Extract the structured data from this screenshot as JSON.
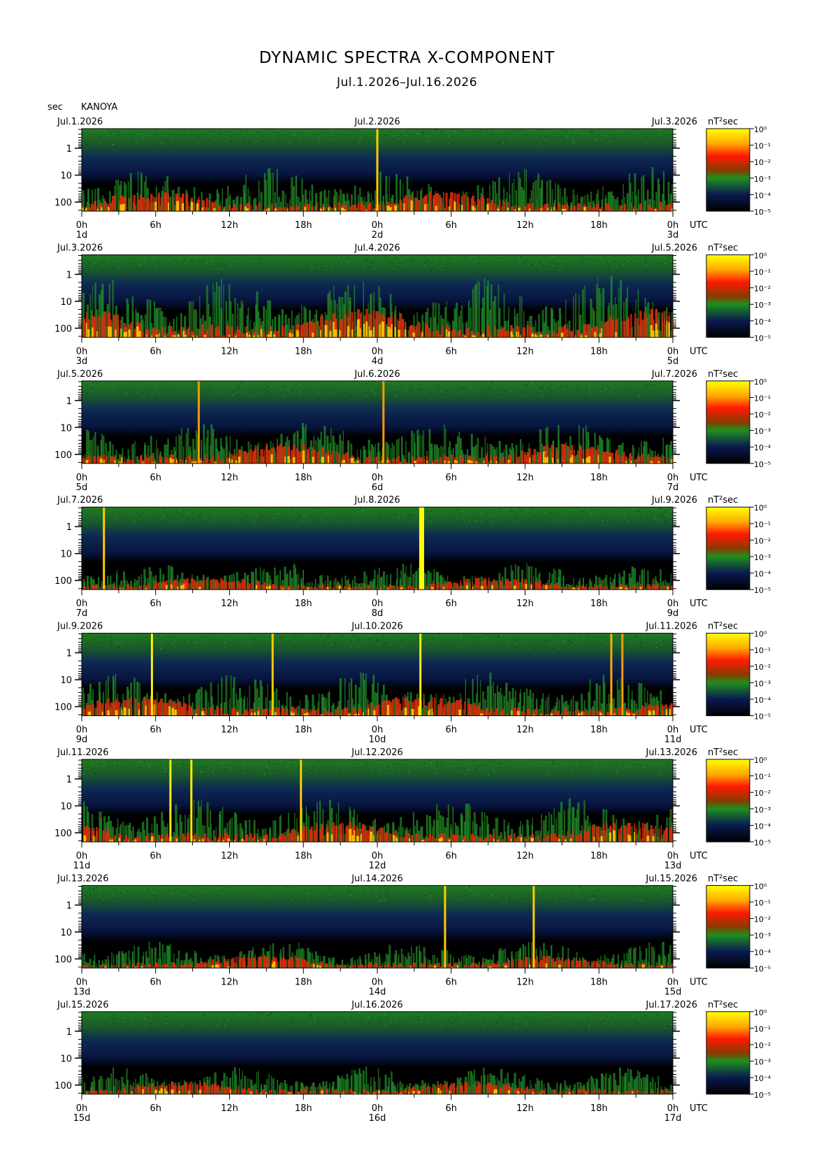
{
  "title": "DYNAMIC SPECTRA X-COMPONENT",
  "subtitle": "Jul.1.2026–Jul.16.2026",
  "y_unit": "sec",
  "station": "KANOYA",
  "chart_data": {
    "type": "heatmap",
    "period_axis": {
      "ticks": [
        "1",
        "10",
        "100"
      ],
      "scale": "log",
      "unit": "sec"
    },
    "time_axis_ticks": [
      "0h",
      "6h",
      "12h",
      "18h",
      "0h",
      "6h",
      "12h",
      "18h",
      "0h"
    ],
    "time_zone_label": "UTC",
    "colorbar": {
      "unit_label": "nT²sec",
      "ticks": [
        "10⁰",
        "10⁻¹",
        "10⁻²",
        "10⁻³",
        "10⁻⁴",
        "10⁻⁵"
      ],
      "colors": [
        "#ffff00",
        "#ff8c00",
        "#ff1a00",
        "#1f8f1f",
        "#0a1a50",
        "#000000"
      ]
    },
    "panels": [
      {
        "dates": [
          "Jul.1.2026",
          "Jul.2.2026",
          "Jul.3.2026"
        ],
        "day_labels": [
          "1d",
          "2d",
          "3d"
        ],
        "spikes": [
          {
            "t": 24.0,
            "color": "#ffcc00"
          }
        ],
        "activity": "moderate"
      },
      {
        "dates": [
          "Jul.3.2026",
          "Jul.4.2026",
          "Jul.5.2026"
        ],
        "day_labels": [
          "3d",
          "4d",
          "5d"
        ],
        "spikes": [],
        "activity": "high"
      },
      {
        "dates": [
          "Jul.5.2026",
          "Jul.6.2026",
          "Jul.7.2026"
        ],
        "day_labels": [
          "5d",
          "6d",
          "7d"
        ],
        "spikes": [
          {
            "t": 9.5,
            "color": "#ff9900"
          },
          {
            "t": 24.5,
            "color": "#ff9900"
          }
        ],
        "activity": "moderate"
      },
      {
        "dates": [
          "Jul.7.2026",
          "Jul.8.2026",
          "Jul.9.2026"
        ],
        "day_labels": [
          "7d",
          "8d",
          "9d"
        ],
        "spikes": [
          {
            "t": 1.8,
            "color": "#ffcc00"
          },
          {
            "t": 27.6,
            "color": "#ffff00"
          }
        ],
        "activity": "low"
      },
      {
        "dates": [
          "Jul.9.2026",
          "Jul.10.2026",
          "Jul.11.2026"
        ],
        "day_labels": [
          "9d",
          "10d",
          "11d"
        ],
        "spikes": [
          {
            "t": 5.7,
            "color": "#ffee00"
          },
          {
            "t": 15.5,
            "color": "#ffcc00"
          },
          {
            "t": 27.5,
            "color": "#ffee00"
          },
          {
            "t": 43.0,
            "color": "#ffaa00"
          },
          {
            "t": 43.9,
            "color": "#ff9900"
          }
        ],
        "activity": "moderate"
      },
      {
        "dates": [
          "Jul.11.2026",
          "Jul.12.2026",
          "Jul.13.2026"
        ],
        "day_labels": [
          "11d",
          "12d",
          "13d"
        ],
        "spikes": [
          {
            "t": 7.2,
            "color": "#ffee00"
          },
          {
            "t": 8.9,
            "color": "#ffee00"
          },
          {
            "t": 17.8,
            "color": "#ffcc00"
          }
        ],
        "activity": "moderate"
      },
      {
        "dates": [
          "Jul.13.2026",
          "Jul.14.2026",
          "Jul.15.2026"
        ],
        "day_labels": [
          "13d",
          "14d",
          "15d"
        ],
        "spikes": [
          {
            "t": 29.5,
            "color": "#ffcc00"
          },
          {
            "t": 36.7,
            "color": "#ffcc00"
          }
        ],
        "activity": "low"
      },
      {
        "dates": [
          "Jul.15.2026",
          "Jul.16.2026",
          "Jul.17.2026"
        ],
        "day_labels": [
          "15d",
          "16d",
          "17d"
        ],
        "spikes": [],
        "activity": "low"
      }
    ]
  }
}
